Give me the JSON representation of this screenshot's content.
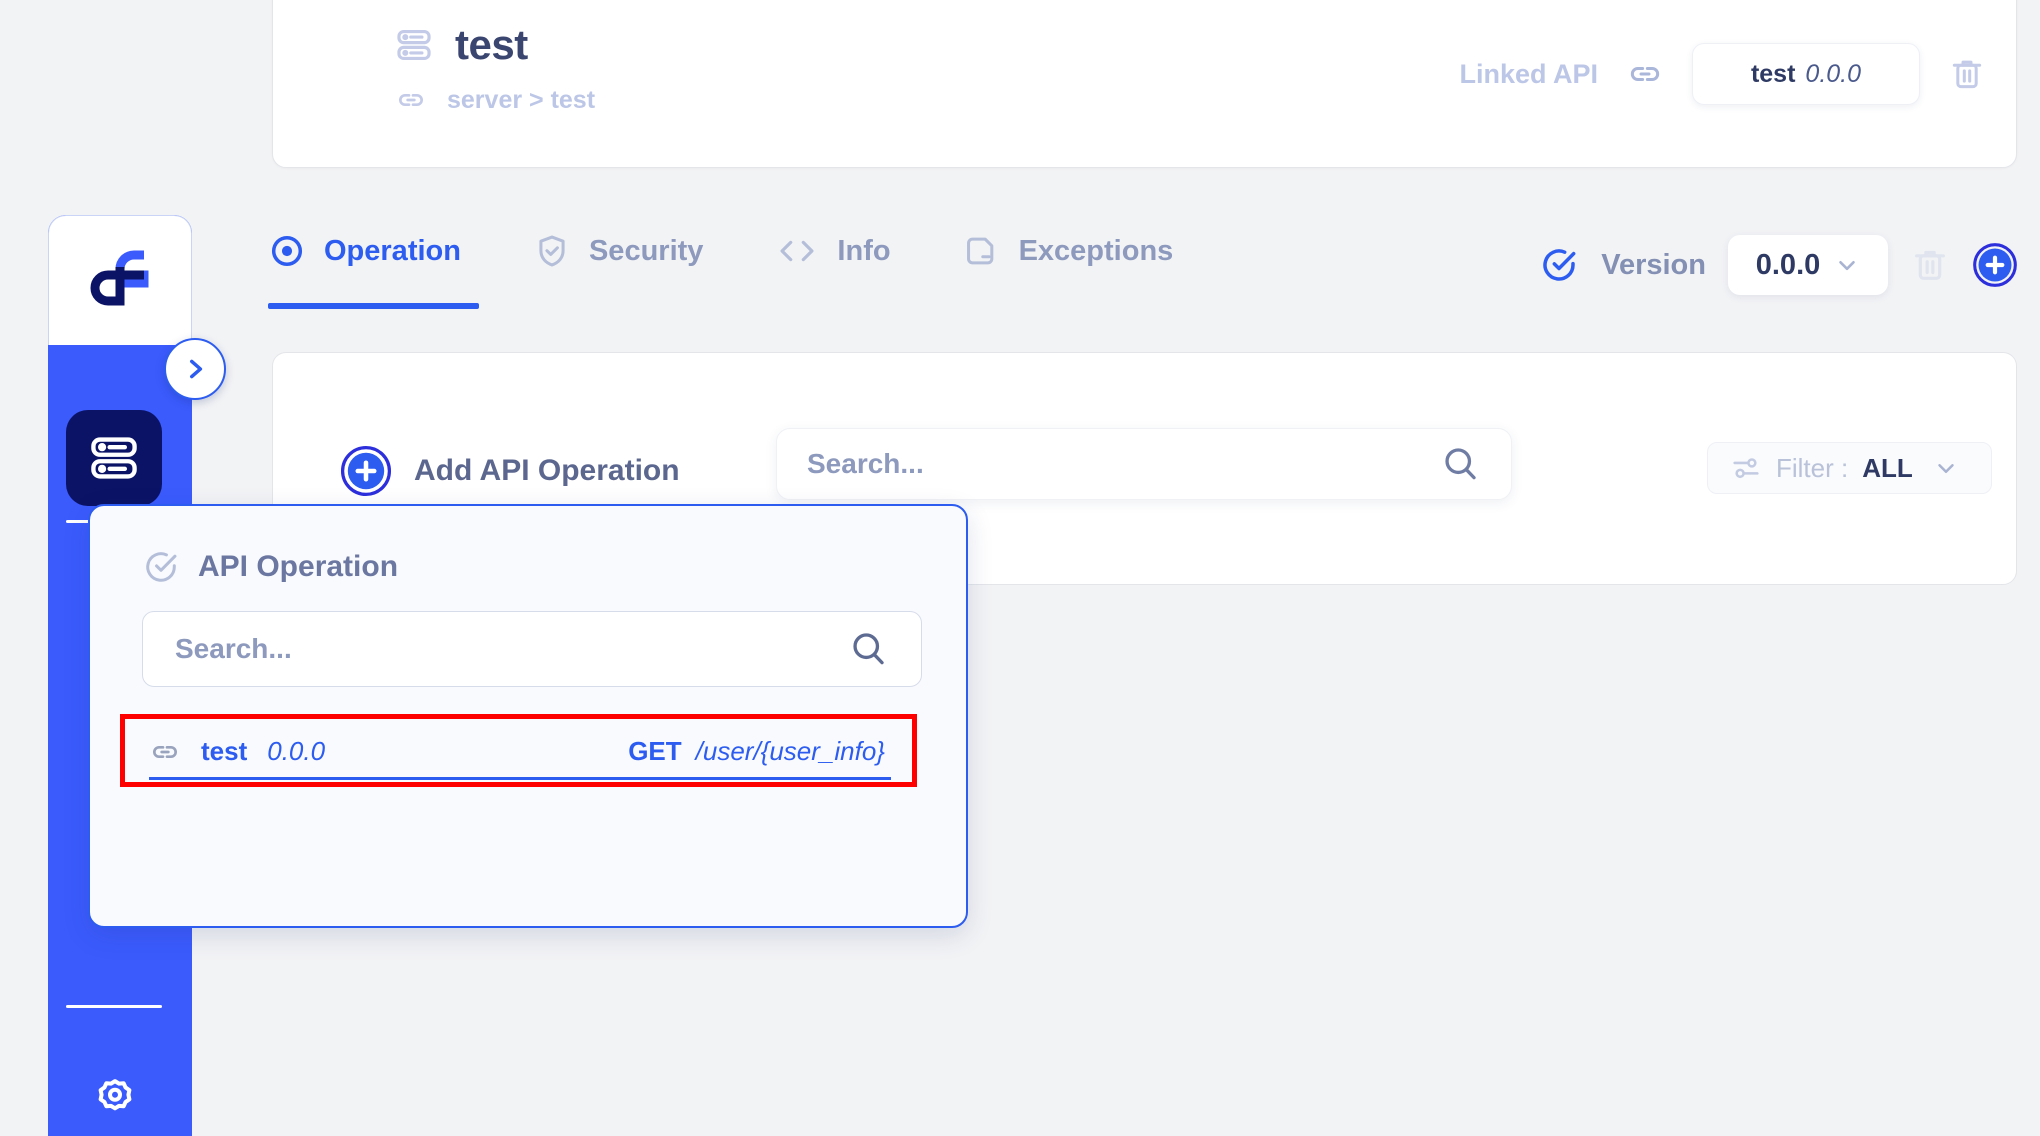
{
  "colors": {
    "accent": "#2c5cf0",
    "rail": "#3b5bfd",
    "rail_item": "#0b1366",
    "muted": "#8d99bd",
    "faint": "#bcc6e6",
    "dark_text": "#2e3a63",
    "page_bg": "#f2f3f5",
    "highlight": "#ff0000"
  },
  "sidebar": {
    "logo_icon": "app-logo-icon",
    "expand_icon": "chevron-right-icon",
    "items": [
      {
        "icon": "server-icon",
        "name": "server-nav-item",
        "active": true
      }
    ],
    "settings_icon": "gear-icon"
  },
  "header": {
    "icon": "server-icon",
    "title": "test",
    "breadcrumb_icon": "link-icon",
    "breadcrumb": "server > test",
    "linked_api_label": "Linked API",
    "linked_api_icon": "link-icon",
    "linked_api": {
      "name": "test",
      "version": "0.0.0"
    },
    "delete_icon": "trash-icon"
  },
  "tabs": [
    {
      "label": "Operation",
      "icon": "target-icon",
      "active": true
    },
    {
      "label": "Security",
      "icon": "shield-check-icon",
      "active": false
    },
    {
      "label": "Info",
      "icon": "code-brackets-icon",
      "active": false
    },
    {
      "label": "Exceptions",
      "icon": "document-minus-icon",
      "active": false
    }
  ],
  "version": {
    "icon": "check-circle-icon",
    "label": "Version",
    "value": "0.0.0",
    "chevron_icon": "chevron-down-icon",
    "delete_icon": "trash-icon",
    "add_icon": "plus-circle-icon"
  },
  "toolbar": {
    "add_operation_label": "Add API Operation",
    "add_operation_icon": "plus-circle-icon",
    "search_placeholder": "Search...",
    "search_value": "",
    "search_icon": "search-icon",
    "filter_icon": "sliders-icon",
    "filter_label": "Filter :",
    "filter_value": "ALL",
    "filter_chevron_icon": "chevron-down-icon"
  },
  "popup": {
    "icon": "check-circle-icon",
    "title": "API Operation",
    "search_placeholder": "Search...",
    "search_value": "",
    "search_icon": "search-icon",
    "results": [
      {
        "icon": "link-icon",
        "name": "test",
        "version": "0.0.0",
        "method": "GET",
        "path": "/user/{user_info}"
      }
    ]
  }
}
